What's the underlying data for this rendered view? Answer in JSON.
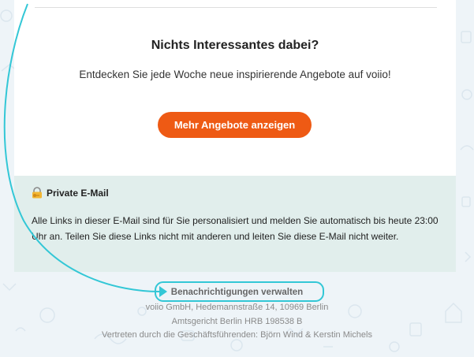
{
  "colors": {
    "page_bg": "#eef4f8",
    "accent": "#ee5a14",
    "private_bg": "#e1eeec",
    "annotation": "#33c7d6"
  },
  "content": {
    "headline": "Nichts Interessantes dabei?",
    "subline": "Entdecken Sie jede Woche neue inspirierende Angebote auf voiio!",
    "cta_label": "Mehr Angebote anzeigen"
  },
  "private_email": {
    "icon": "lock-key-icon",
    "title": "Private E-Mail",
    "text": "Alle Links in dieser E-Mail sind für Sie personalisiert und melden Sie automatisch bis heute 23:00 Uhr an. Teilen Sie diese Links nicht mit anderen und leiten Sie diese E-Mail nicht weiter."
  },
  "footer": {
    "manage_link": "Benachrichtigungen verwalten",
    "address": "voiio GmbH, Hedemannstraße 14, 10969 Berlin",
    "court": "Amtsgericht Berlin HRB 198538 B",
    "directors": "Vertreten durch die Geschäftsführenden: Björn Wind & Kerstin Michels"
  }
}
